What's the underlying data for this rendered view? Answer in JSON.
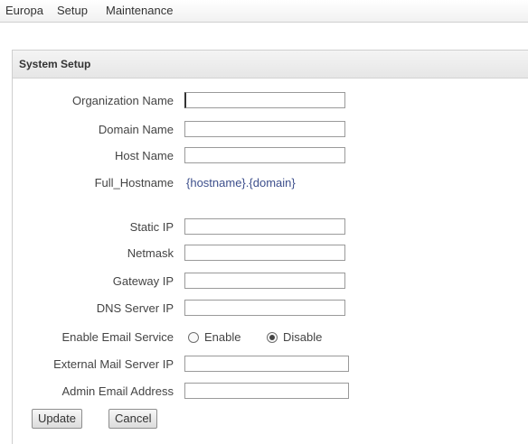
{
  "menu": {
    "items": [
      "Europa",
      "Setup",
      "Maintenance"
    ]
  },
  "panel": {
    "title": "System Setup"
  },
  "form": {
    "organization_name": {
      "label": "Organization Name",
      "value": ""
    },
    "domain_name": {
      "label": "Domain Name",
      "value": ""
    },
    "host_name": {
      "label": "Host Name",
      "value": ""
    },
    "full_hostname": {
      "label": "Full_Hostname",
      "value": "{hostname}.{domain}"
    },
    "static_ip": {
      "label": "Static IP",
      "value": ""
    },
    "netmask": {
      "label": "Netmask",
      "value": ""
    },
    "gateway_ip": {
      "label": "Gateway IP",
      "value": ""
    },
    "dns_server_ip": {
      "label": "DNS Server IP",
      "value": ""
    },
    "email_service": {
      "label": "Enable Email Service",
      "options": [
        "Enable",
        "Disable"
      ],
      "selected": "Disable"
    },
    "external_mail_server_ip": {
      "label": "External Mail Server IP",
      "value": ""
    },
    "admin_email_address": {
      "label": "Admin Email Address",
      "value": ""
    }
  },
  "buttons": {
    "update": "Update",
    "cancel": "Cancel"
  }
}
